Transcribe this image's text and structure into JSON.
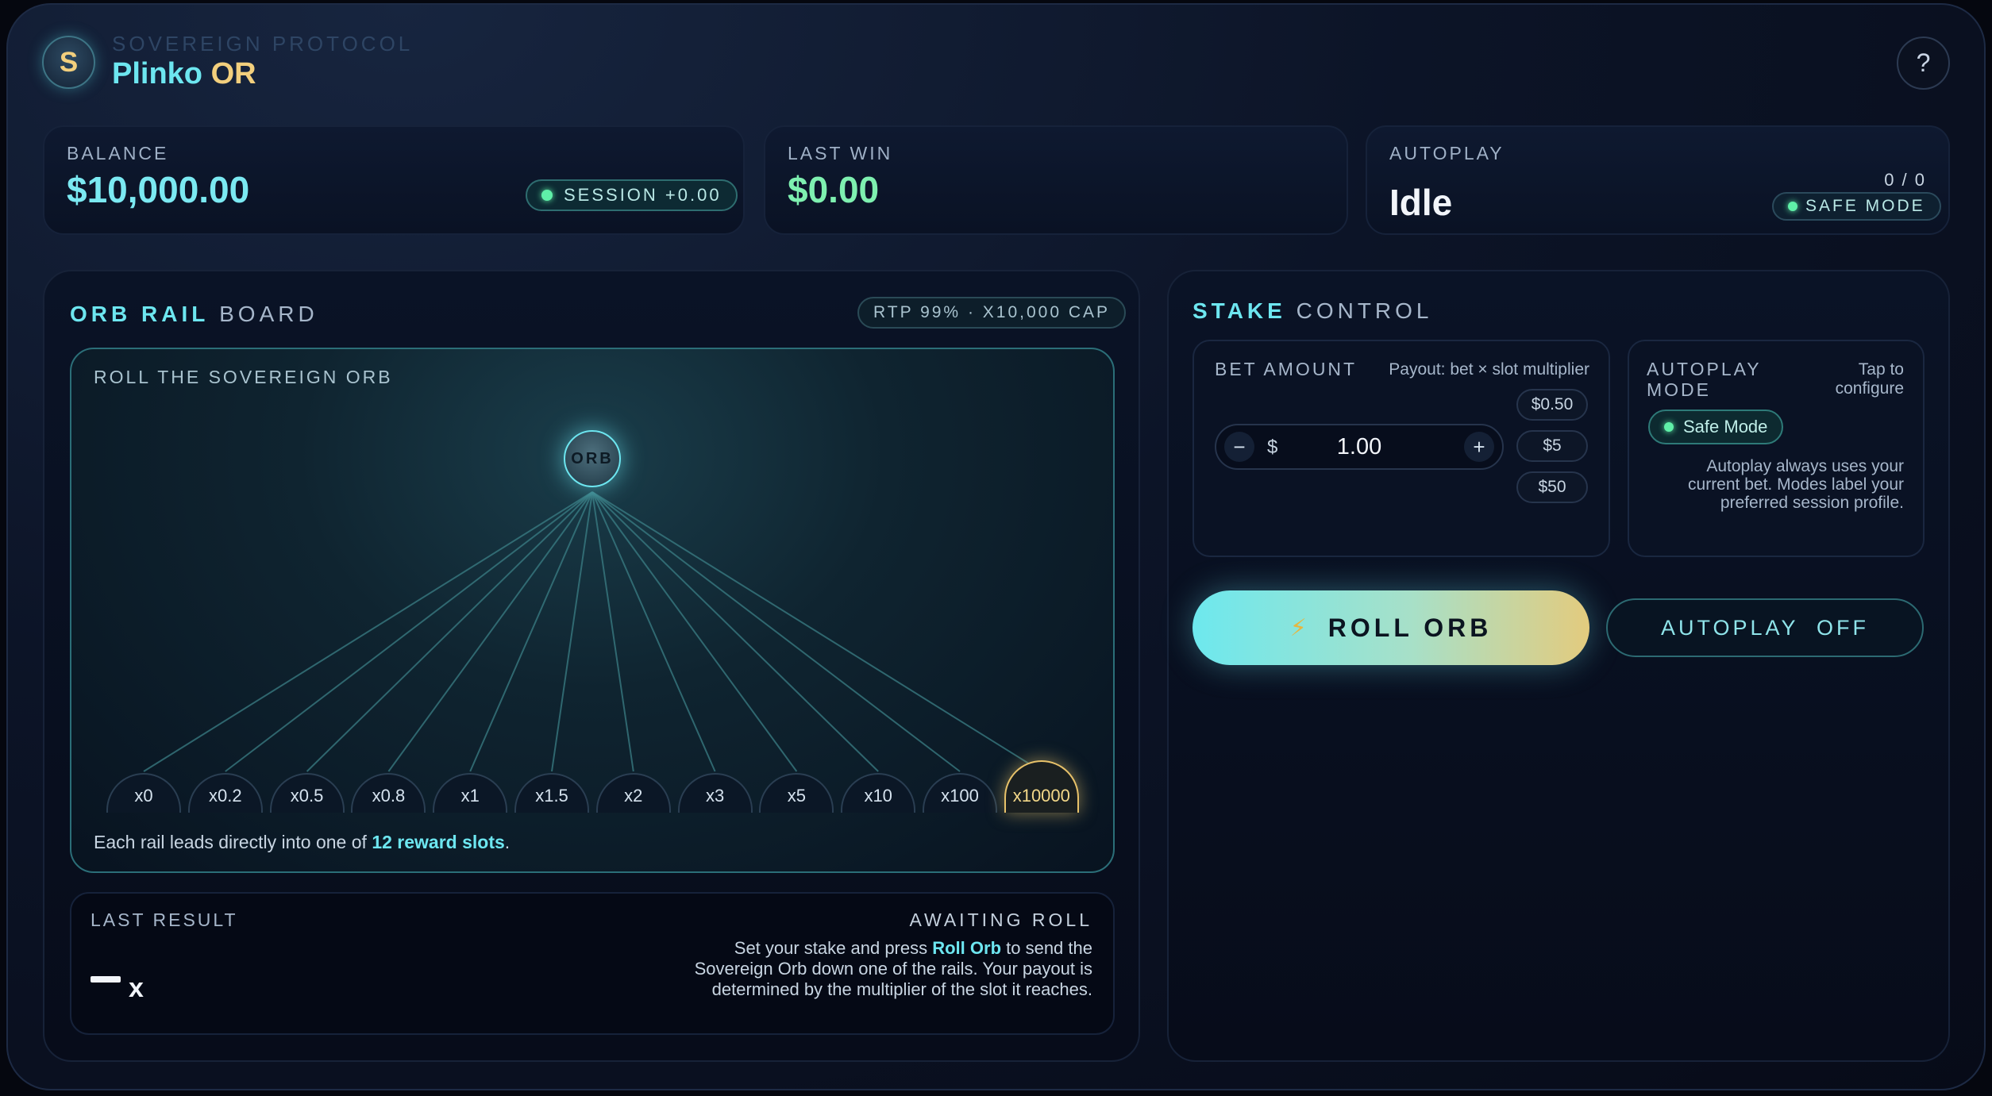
{
  "brand": {
    "logo_letter": "S",
    "supertitle": "SOVEREIGN PROTOCOL",
    "title_main": "Plinko",
    "title_accent": "OR"
  },
  "help": {
    "label": "?"
  },
  "stats": {
    "balance": {
      "label": "BALANCE",
      "value": "$10,000.00",
      "session": "SESSION +0.00"
    },
    "last_win": {
      "label": "LAST WIN",
      "value": "$0.00"
    },
    "autoplay": {
      "label": "AUTOPLAY",
      "value": "Idle",
      "count": "0 / 0",
      "mode": "SAFE MODE"
    }
  },
  "board": {
    "title_hl": "ORB RAIL",
    "title_rest": "BOARD",
    "rtp": "RTP 99% · X10,000 CAP",
    "label": "ROLL THE SOVEREIGN ORB",
    "orb": "ORB",
    "slots": [
      "x0",
      "x0.2",
      "x0.5",
      "x0.8",
      "x1",
      "x1.5",
      "x2",
      "x3",
      "x5",
      "x10",
      "x100",
      "x10000"
    ],
    "foot_pre": "Each rail leads directly into one of ",
    "foot_hl": "12 reward slots",
    "foot_post": "."
  },
  "result": {
    "label": "LAST RESULT",
    "status": "AWAITING ROLL",
    "value_suffix": "x",
    "desc_pre": "Set your stake and press ",
    "desc_hl": "Roll Orb",
    "desc_post": " to send the Sovereign Orb down one of the rails. Your payout is determined by the multiplier of the slot it reaches."
  },
  "stake": {
    "title_hl": "STAKE",
    "title_rest": "CONTROL",
    "bet_label": "BET AMOUNT",
    "payout_note": "Payout: bet × slot multiplier",
    "minus": "−",
    "plus": "+",
    "currency": "$",
    "amount": "1.00",
    "chips": [
      "$0.50",
      "$5",
      "$50"
    ],
    "autoplay_label": "AUTOPLAY MODE",
    "tap_hint": "Tap to configure",
    "mode_pill": "Safe Mode",
    "autoplay_note": "Autoplay always uses your current bet. Modes label your preferred session profile."
  },
  "actions": {
    "roll_icon": "⚡",
    "roll": "ROLL ORB",
    "autoplay": "AUTOPLAY  OFF"
  },
  "colors": {
    "accent": "#6de6f0",
    "gold": "#e8c26a",
    "win": "#7ef0b0"
  }
}
